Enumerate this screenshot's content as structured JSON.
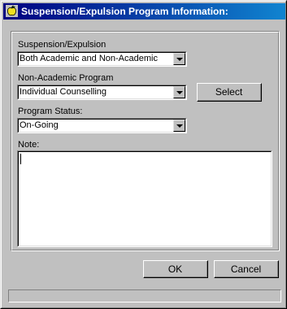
{
  "window": {
    "title": "Suspension/Expulsion Program Information:",
    "icon": "app-apple-icon"
  },
  "form": {
    "suspension": {
      "label": "Suspension/Expulsion",
      "value": "Both Academic and Non-Academic"
    },
    "program": {
      "label": "Non-Academic Program",
      "value": "Individual Counselling",
      "select_label": "Select"
    },
    "status": {
      "label": "Program Status:",
      "value": "On-Going"
    },
    "note": {
      "label": "Note:",
      "value": ""
    }
  },
  "buttons": {
    "ok_label": "OK",
    "cancel_label": "Cancel"
  },
  "statusbar": {
    "text": ""
  }
}
